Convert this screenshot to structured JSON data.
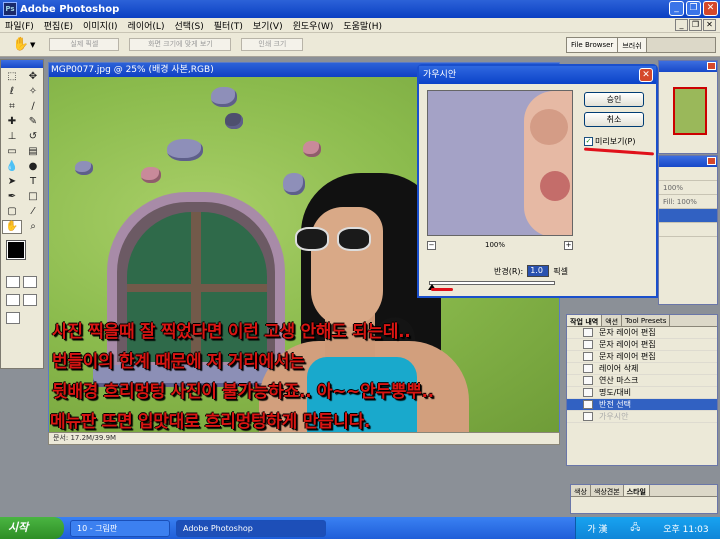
{
  "window": {
    "title": "Adobe Photoshop",
    "icon_text": "Ps"
  },
  "menu": [
    "파일(F)",
    "편집(E)",
    "이미지(I)",
    "레이어(L)",
    "선택(S)",
    "필터(T)",
    "보기(V)",
    "윈도우(W)",
    "도움말(H)"
  ],
  "options": {
    "buttons": [
      "실제 픽셀",
      "화면 크기에 맞게 보기",
      "인쇄 크기"
    ],
    "palette_tabs": [
      "File Browser",
      "브러쉬"
    ]
  },
  "document": {
    "title": "MGP0077.jpg @ 25% (배경 사본,RGB)",
    "status": "문서: 17.2M/39.9M"
  },
  "captions": [
    "사진 찍을때  잘 찍었다면 이런 고생 안해도 되는데..",
    "번들이의 한계 때문에 저 거리에서는",
    "뒷배경 흐리멍텅 사진이 불가능하죠.. 아~~안두뿡뿌..",
    "메뉴판 뜨면 입맛대로 흐리멍텅하게 만듭니다."
  ],
  "dialog": {
    "title": "가우시안",
    "ok": "승인",
    "cancel": "취소",
    "preview_label": "미리보기(P)",
    "preview_checked": true,
    "zoom": "100%",
    "radius_label": "반경(R):",
    "radius_value": "1.0",
    "radius_unit": "픽셀",
    "radius_slider_fraction": 0.02
  },
  "layers_panel": {
    "rows": [
      "",
      "100%",
      "Fill: 100%",
      "",
      ""
    ]
  },
  "history_panel": {
    "tabs": [
      "작업 내역",
      "액션",
      "Tool Presets"
    ],
    "items": [
      {
        "label": "문자 레이어 편집",
        "state": "normal"
      },
      {
        "label": "문자 레이어 편집",
        "state": "normal"
      },
      {
        "label": "문자 레이어 편집",
        "state": "normal"
      },
      {
        "label": "레이어 삭제",
        "state": "normal"
      },
      {
        "label": "연산 마스크",
        "state": "normal"
      },
      {
        "label": "명도/대비",
        "state": "normal"
      },
      {
        "label": "반전 선택",
        "state": "selected"
      },
      {
        "label": "가우시안",
        "state": "dim"
      }
    ]
  },
  "swatches_panel": {
    "tabs": [
      "색상",
      "색상견본",
      "스타일"
    ]
  },
  "taskbar": {
    "start": "시작",
    "tasks": [
      "10 - 그림판",
      "Adobe Photoshop"
    ],
    "ime": "가 漢",
    "clock": "오후 11:03"
  },
  "colors": {
    "title_blue": "#0a3fc2",
    "caption_red": "#d81512",
    "selected_row": "#3161c2"
  }
}
